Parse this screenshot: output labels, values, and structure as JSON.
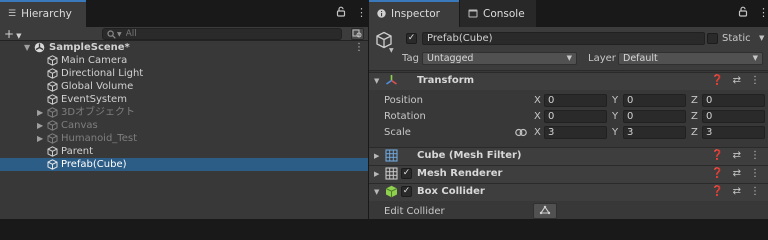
{
  "hierarchy": {
    "tab_label": "Hierarchy",
    "search_placeholder": "All",
    "add_label": "+",
    "scene_name": "SampleScene*",
    "items": [
      {
        "label": "Main Camera"
      },
      {
        "label": "Directional Light"
      },
      {
        "label": "Global Volume"
      },
      {
        "label": "EventSystem"
      },
      {
        "label": "3Dオブジェクト"
      },
      {
        "label": "Canvas"
      },
      {
        "label": "Humanoid_Test"
      },
      {
        "label": "Parent"
      },
      {
        "label": "Prefab(Cube)"
      }
    ]
  },
  "inspector": {
    "tabs": [
      {
        "label": "Inspector"
      },
      {
        "label": "Console"
      }
    ],
    "object_name": "Prefab(Cube)",
    "active": true,
    "static_label": "Static",
    "tag_label": "Tag",
    "tag_value": "Untagged",
    "layer_label": "Layer",
    "layer_value": "Default",
    "transform": {
      "title": "Transform",
      "position_label": "Position",
      "rotation_label": "Rotation",
      "scale_label": "Scale",
      "position": {
        "x": "0",
        "y": "0",
        "z": "0"
      },
      "rotation": {
        "x": "0",
        "y": "0",
        "z": "0"
      },
      "scale": {
        "x": "3",
        "y": "3",
        "z": "3"
      }
    },
    "components": {
      "mesh_filter": "Cube (Mesh Filter)",
      "mesh_renderer": "Mesh Renderer",
      "box_collider": "Box Collider"
    },
    "edit_collider_label": "Edit Collider",
    "axis_labels": {
      "x": "X",
      "y": "Y",
      "z": "Z"
    }
  },
  "colors": {
    "selection": "#2c5d87",
    "tab_accent": "#3a79bb",
    "panel_bg": "#383838",
    "field_bg": "#2a2a2a"
  }
}
